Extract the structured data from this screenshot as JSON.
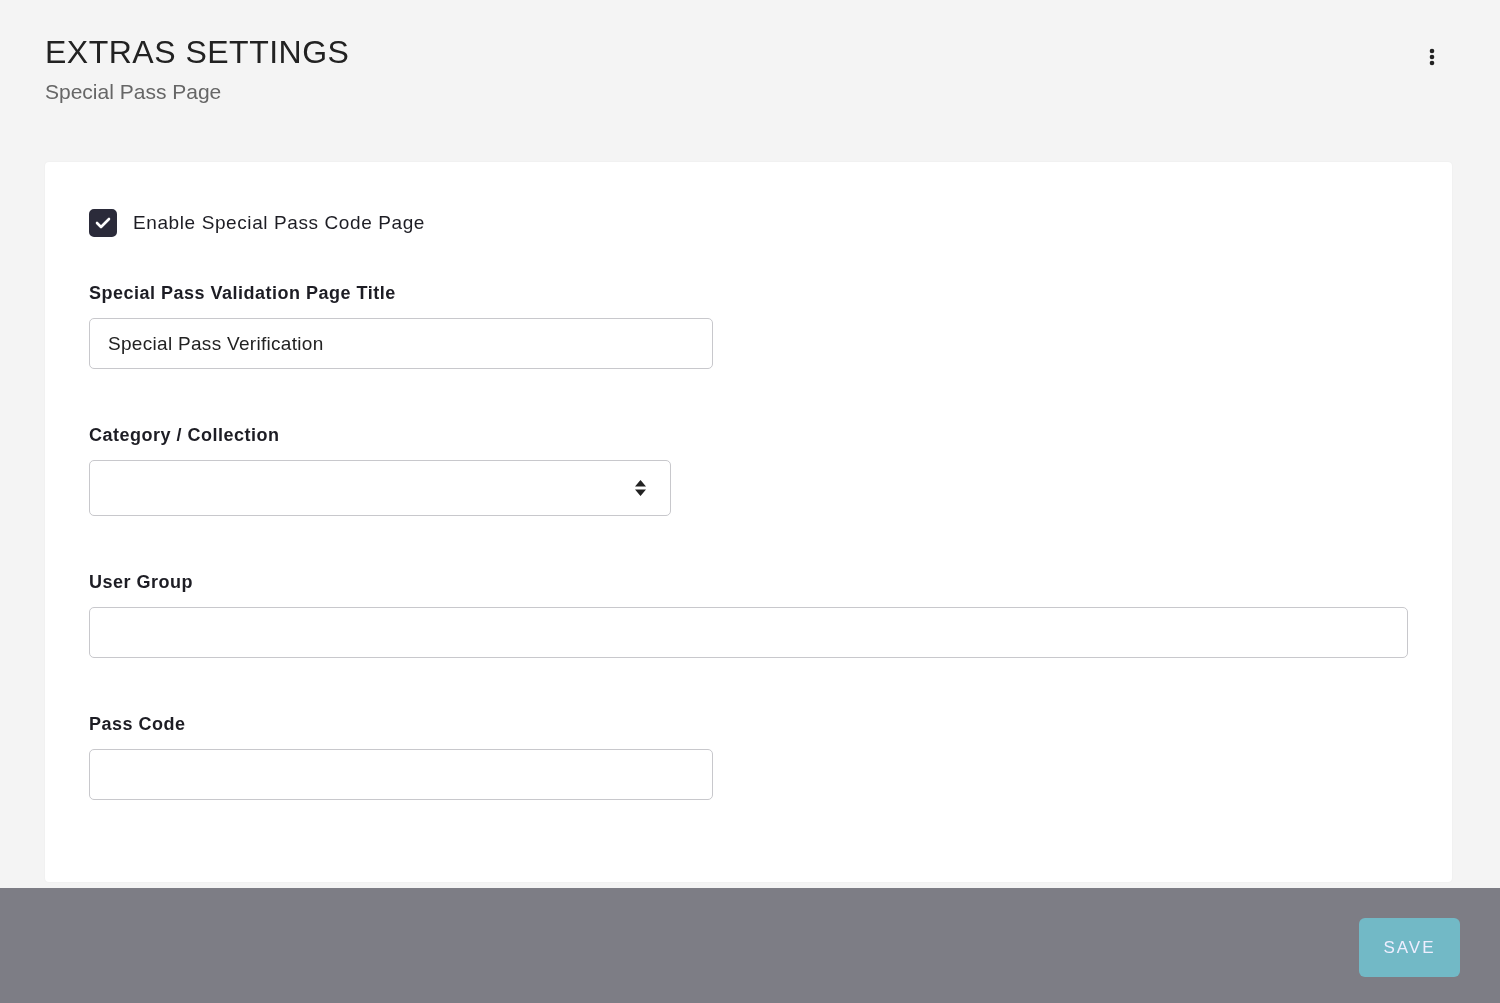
{
  "header": {
    "title": "EXTRAS SETTINGS",
    "subtitle": "Special Pass Page"
  },
  "form": {
    "checkbox": {
      "label": "Enable Special Pass Code Page",
      "checked": true
    },
    "fields": [
      {
        "kind": "short-text",
        "label": "Special Pass Validation Page Title",
        "value": "Special Pass Verification"
      },
      {
        "kind": "select",
        "label": "Category / Collection"
      },
      {
        "kind": "long-text",
        "label": "User Group"
      },
      {
        "kind": "short-text",
        "label": "Pass Code"
      }
    ]
  },
  "footer": {
    "save_button": "SAVE"
  }
}
